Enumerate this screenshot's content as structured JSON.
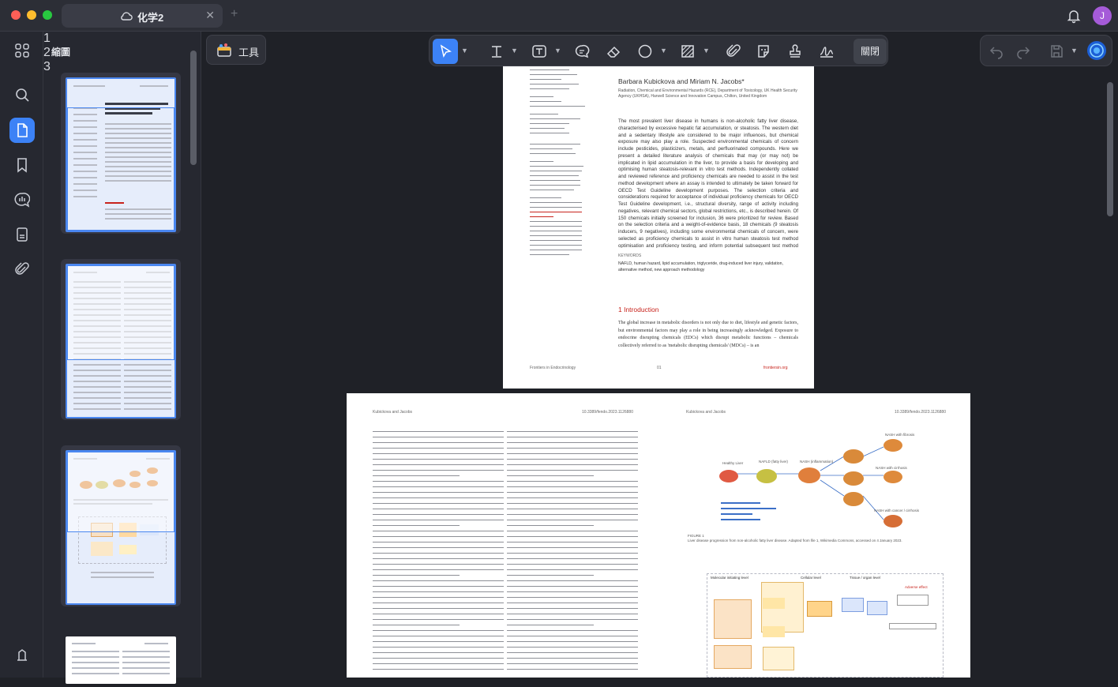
{
  "tab": {
    "title": "化学2",
    "icons": [
      "cloud-icon",
      "close-icon"
    ]
  },
  "user": {
    "initial": "J",
    "color": "#a55bd8"
  },
  "rail": {
    "items": [
      "grid-icon",
      "search-icon",
      "pages-icon",
      "bookmark-icon",
      "comment-icon",
      "document-icon",
      "attachment-icon",
      "settings-icon"
    ]
  },
  "thumb_panel": {
    "title": "縮圖",
    "pages": [
      {
        "num": "1"
      },
      {
        "num": "2"
      },
      {
        "num": "3"
      }
    ]
  },
  "toolbar": {
    "tools_label": "工具",
    "close_label": "關閉",
    "tools": [
      "select-icon",
      "text-icon",
      "textbox-icon",
      "comment-icon",
      "eraser-icon",
      "shape-icon",
      "area-icon",
      "attach-icon",
      "sticker-icon",
      "stamp-icon",
      "signature-icon"
    ]
  },
  "accent": "#3c82f6",
  "page1": {
    "authors": "Barbara Kubickova and Miriam N. Jacobs*",
    "affil": "Radiation, Chemical and Environmental Hazards (RCE), Department of Toxicology, UK Health Security Agency (UKHSA), Harwell Science and Innovation Campus, Chilton, United Kingdom",
    "abstract": "The most prevalent liver disease in humans is non-alcoholic fatty liver disease, characterised by excessive hepatic fat accumulation, or steatosis. The western diet and a sedentary lifestyle are considered to be major influences, but chemical exposure may also play a role. Suspected environmental chemicals of concern include pesticides, plasticizers, metals, and perfluorinated compounds. Here we present a detailed literature analysis of chemicals that may (or may not) be implicated in lipid accumulation in the liver, to provide a basis for developing and optimising human steatosis-relevant in vitro test methods. Independently collated and reviewed reference and proficiency chemicals are needed to assist in the test method development where an assay is intended to ultimately be taken forward for OECD Test Guideline development purposes. The selection criteria and considerations required for acceptance of individual proficiency chemicals for OECD Test Guideline development, i.e., structural diversity, range of activity including negatives, relevant chemical sectors, global restrictions, etc., is described herein. Of 150 chemicals initially screened for inclusion, 36 were prioritized for review. Based on the selection criteria and a weight-of-evidence basis, 18 chemicals (9 steatosis inducers, 9 negatives), including some environmental chemicals of concern, were selected as proficiency chemicals to assist in vitro human steatosis test method optimisation and proficiency testing, and inform potential subsequent test method formal validation.",
    "keywords_label": "KEYWORDS",
    "keywords": "NAFLD, human hazard, lipid accumulation, triglyceride, drug-induced liver injury, validation, alternative method, new approach methodology",
    "intro_heading": "1 Introduction",
    "intro_text": "The global increase in metabolic disorders is not only due to diet, lifestyle and genetic factors, but environmental factors may play a role in being increasingly acknowledged. Exposure to endocrine disrupting chemicals (EDCs) which disrupt metabolic functions – chemicals collectively referred to as 'metabolic disrupting chemicals' (MDCs) – is an",
    "footer_left": "Frontiers in Endocrinology",
    "footer_page": "01",
    "footer_right": "frontiersin.org"
  },
  "page2": {
    "header_left": "Kubickova and Jacobs",
    "header_right": "10.3389/fendo.2023.1126880",
    "header_left_b": "Kubickova and Jacobs",
    "header_right_b": "10.3389/fendo.2023.1126880",
    "figure_caption": "FIGURE 1\nLiver disease progression from non-alcoholic fatty liver disease. Adapted from file 1, Wikimedia Commons, accessed on 4 January 2023.",
    "nash_labels": [
      "NASH with fibrosis",
      "Healthy Liver",
      "NAFLD (fatty liver)",
      "NASH (inflammation)",
      "NASH with cirrhosis",
      "NASH with cancer / cirrhosis"
    ],
    "flow_labels": [
      "Molecular initiating level",
      "Cellular level",
      "Tissue / organ level",
      "Adverse effect"
    ]
  }
}
